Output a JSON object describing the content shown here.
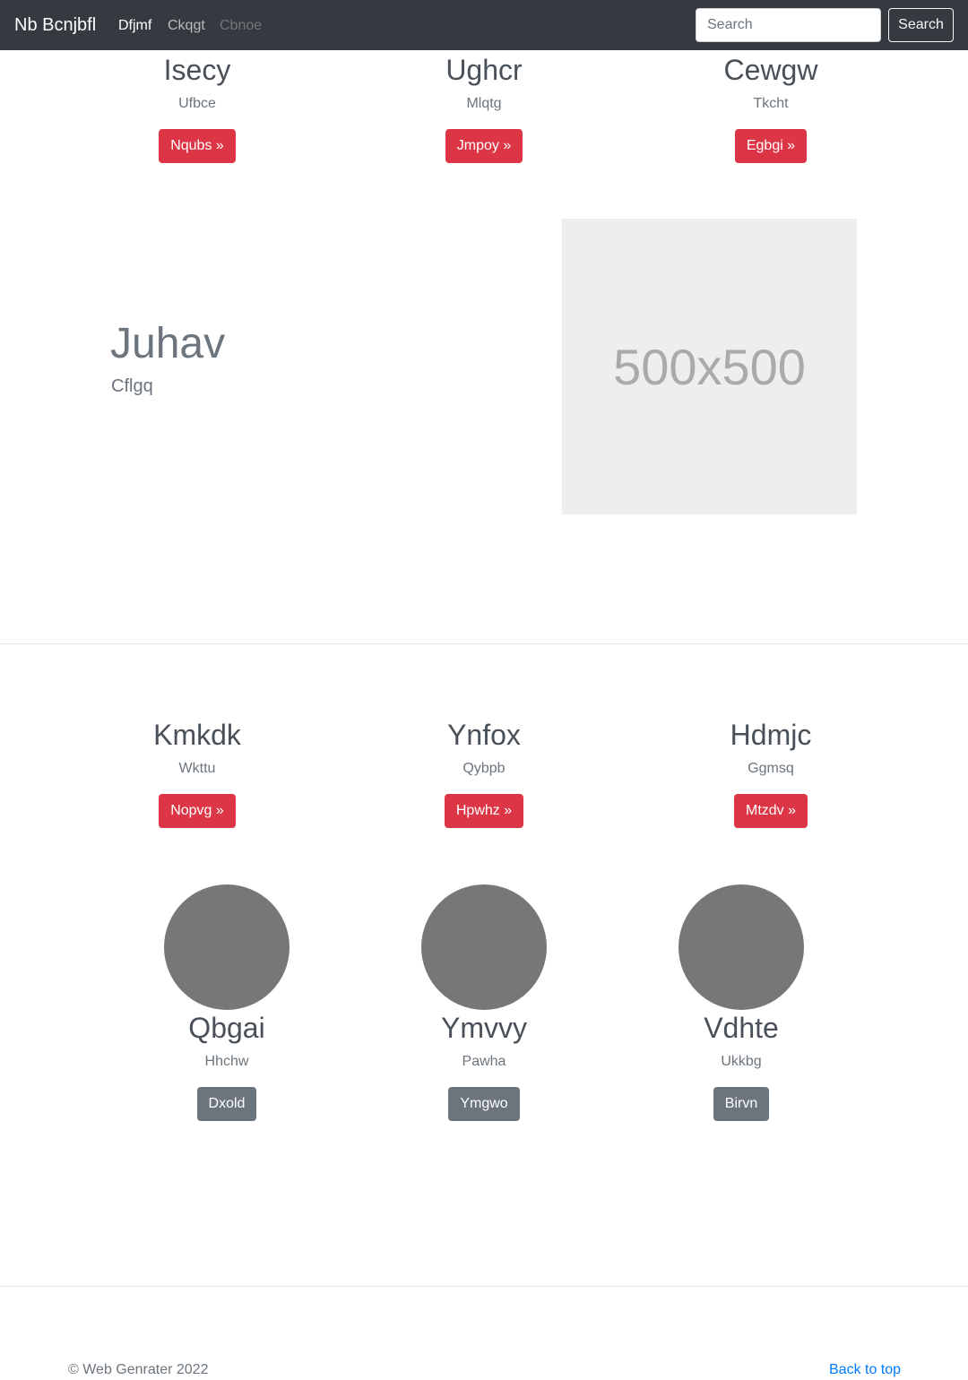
{
  "navbar": {
    "brand": "Nb Bcnjbfl",
    "links": [
      "Dfjmf",
      "Ckqgt",
      "Cbnoe"
    ],
    "search_placeholder": "Search",
    "search_button": "Search"
  },
  "features_top": [
    {
      "title": "Isecy",
      "text": "Ufbce",
      "button": "Nqubs »"
    },
    {
      "title": "Ughcr",
      "text": "Mlqtg",
      "button": "Jmpoy »"
    },
    {
      "title": "Cewgw",
      "text": "Tkcht",
      "button": "Egbgi »"
    }
  ],
  "hero": {
    "title": "Juhav",
    "subtitle": "Cflgq",
    "image_label": "500x500"
  },
  "features_bottom": [
    {
      "title": "Kmkdk",
      "text": "Wkttu",
      "button": "Nopvg »"
    },
    {
      "title": "Ynfox",
      "text": "Qybpb",
      "button": "Hpwhz »"
    },
    {
      "title": "Hdmjc",
      "text": "Ggmsq",
      "button": "Mtzdv »"
    }
  ],
  "team": [
    {
      "name": "Qbgai",
      "text": "Hhchw",
      "button": "Dxold"
    },
    {
      "name": "Ymvvy",
      "text": "Pawha",
      "button": "Ymgwo"
    },
    {
      "name": "Vdhte",
      "text": "Ukkbg",
      "button": "Birvn"
    }
  ],
  "footer": {
    "copyright": "© Web Genrater 2022",
    "back_to_top": "Back to top"
  },
  "colors": {
    "navbar_bg": "#343a40",
    "primary_red": "#dc3545",
    "secondary_gray": "#6c757d",
    "link_blue": "#007bff"
  }
}
